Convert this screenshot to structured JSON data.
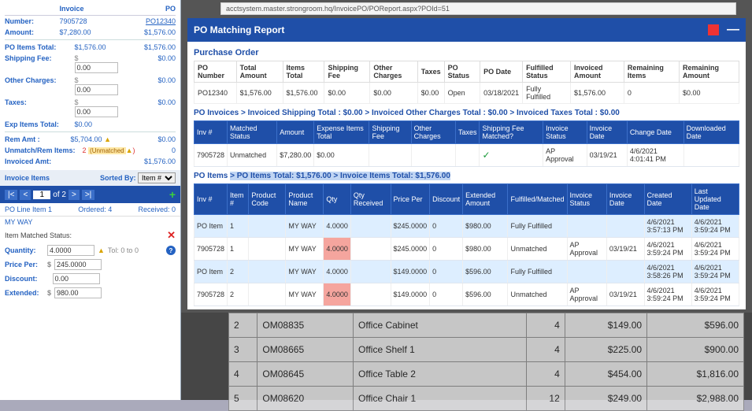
{
  "left": {
    "headers": {
      "invoice": "Invoice",
      "po": "PO"
    },
    "number_lbl": "Number:",
    "number_inv": "7905728",
    "number_po": "PO12340",
    "amount_lbl": "Amount:",
    "amount_inv": "$7,280.00",
    "amount_po": "$1,576.00",
    "poitems_lbl": "PO Items Total:",
    "poitems_inv": "$1,576.00",
    "poitems_po": "$1,576.00",
    "ship_lbl": "Shipping Fee:",
    "ship_inv": "0.00",
    "ship_po": "$0.00",
    "other_lbl": "Other Charges:",
    "other_inv": "0.00",
    "other_po": "$0.00",
    "taxes_lbl": "Taxes:",
    "taxes_inv": "0.00",
    "taxes_po": "$0.00",
    "exp_lbl": "Exp Items Total:",
    "exp_inv": "$0.00",
    "rem_lbl": "Rem Amt :",
    "rem_inv": "$5,704.00",
    "rem_po": "$0.00",
    "unmatch_lbl": "Unmatch/Rem Items:",
    "unmatch_val": "2",
    "unmatch_txt": "(Unmatched",
    "unmatch_po": "0",
    "invamt_lbl": "Invoiced Amt:",
    "invamt_po": "$1,576.00",
    "invoice_items": "Invoice Items",
    "sorted_by": "Sorted By:",
    "sort_option": "Item #",
    "nav_page": "1",
    "nav_of": "of 2",
    "line_label": "PO Line Item 1",
    "ordered": "Ordered: 4",
    "received": "Received: 0",
    "item_name": "MY WAY",
    "matched_status_lbl": "Item Matched Status:",
    "qty_lbl": "Quantity:",
    "qty_val": "4.0000",
    "tol": "Tol: 0 to 0",
    "price_lbl": "Price Per:",
    "price_val": "245.0000",
    "disc_lbl": "Discount:",
    "disc_val": "0.00",
    "ext_lbl": "Extended:",
    "ext_val": "980.00"
  },
  "url": "acctsystem.master.strongroom.hq/InvoicePO/POReport.aspx?POId=51",
  "report": {
    "title": "PO Matching Report",
    "po_header": "Purchase Order",
    "po_cols": [
      "PO Number",
      "Total Amount",
      "Items Total",
      "Shipping Fee",
      "Other Charges",
      "Taxes",
      "PO Status",
      "PO Date",
      "Fulfilled Status",
      "Invoiced Amount",
      "Remaining Items",
      "Remaining Amount"
    ],
    "po_row": [
      "PO12340",
      "$1,576.00",
      "$1,576.00",
      "$0.00",
      "$0.00",
      "$0.00",
      "Open",
      "03/18/2021",
      "Fully Fulfilled",
      "$1,576.00",
      "0",
      "$0.00"
    ],
    "po_inv_line": "PO Invoices > Invoiced Shipping Total : $0.00 > Invoiced Other Charges Total : $0.00 > Invoiced Taxes Total : $0.00",
    "inv_cols": [
      "Inv #",
      "Matched Status",
      "Amount",
      "Expense Items Total",
      "Shipping Fee",
      "Other Charges",
      "Taxes",
      "Shipping Fee Matched?",
      "Invoice Status",
      "Invoice Date",
      "Change Date",
      "Downloaded Date"
    ],
    "inv_row": {
      "inv": "7905728",
      "status": "Unmatched",
      "amount": "$7,280.00",
      "exp": "$0.00",
      "ship": "",
      "other": "",
      "tax": "",
      "matched": "✓",
      "istatus": "AP Approval",
      "idate": "03/19/21",
      "cdate": "4/6/2021 4:01:41 PM",
      "ddate": ""
    },
    "po_items_prefix": "PO Items ",
    "po_items_hl1": "> PO Items Total: $1,576.00",
    "po_items_hl2": " > Invoice Items Total: $1,576.00",
    "item_cols": [
      "Inv #",
      "Item #",
      "Product Code",
      "Product Name",
      "Qty",
      "Qty Received",
      "Price Per",
      "Discount",
      "Extended Amount",
      "Fulfilled/Matched",
      "Invoice Status",
      "Invoice Date",
      "Created Date",
      "Last Updated Date"
    ],
    "items": [
      {
        "inv": "PO Item",
        "num": "1",
        "code": "",
        "name": "MY WAY",
        "qty": "4.0000",
        "qtyr": "",
        "price": "$245.0000",
        "disc": "0",
        "ext": "$980.00",
        "fm": "Fully Fulfilled",
        "istat": "",
        "idate": "",
        "cdate": "4/6/2021 3:57:13 PM",
        "udate": "4/6/2021 3:59:24 PM",
        "alt": true,
        "red": false
      },
      {
        "inv": "7905728",
        "num": "1",
        "code": "",
        "name": "MY WAY",
        "qty": "4.0000",
        "qtyr": "",
        "price": "$245.0000",
        "disc": "0",
        "ext": "$980.00",
        "fm": "Unmatched",
        "istat": "AP Approval",
        "idate": "03/19/21",
        "cdate": "4/6/2021 3:59:24 PM",
        "udate": "4/6/2021 3:59:24 PM",
        "alt": false,
        "red": true
      },
      {
        "inv": "PO Item",
        "num": "2",
        "code": "",
        "name": "MY WAY",
        "qty": "4.0000",
        "qtyr": "",
        "price": "$149.0000",
        "disc": "0",
        "ext": "$596.00",
        "fm": "Fully Fulfilled",
        "istat": "",
        "idate": "",
        "cdate": "4/6/2021 3:58:26 PM",
        "udate": "4/6/2021 3:59:24 PM",
        "alt": true,
        "red": false
      },
      {
        "inv": "7905728",
        "num": "2",
        "code": "",
        "name": "MY WAY",
        "qty": "4.0000",
        "qtyr": "",
        "price": "$149.0000",
        "disc": "0",
        "ext": "$596.00",
        "fm": "Unmatched",
        "istat": "AP Approval",
        "idate": "03/19/21",
        "cdate": "4/6/2021 3:59:24 PM",
        "udate": "4/6/2021 3:59:24 PM",
        "alt": false,
        "red": true
      }
    ]
  },
  "bg": {
    "rows": [
      {
        "n": "2",
        "code": "OM08835",
        "name": "Office Cabinet",
        "q": "4",
        "price": "$149.00",
        "ext": "$596.00"
      },
      {
        "n": "3",
        "code": "OM08665",
        "name": "Office Shelf 1",
        "q": "4",
        "price": "$225.00",
        "ext": "$900.00"
      },
      {
        "n": "4",
        "code": "OM08645",
        "name": "Office Table 2",
        "q": "4",
        "price": "$454.00",
        "ext": "$1,816.00"
      },
      {
        "n": "5",
        "code": "OM08620",
        "name": "Office Chair 1",
        "q": "12",
        "price": "$249.00",
        "ext": "$2,988.00"
      }
    ]
  }
}
